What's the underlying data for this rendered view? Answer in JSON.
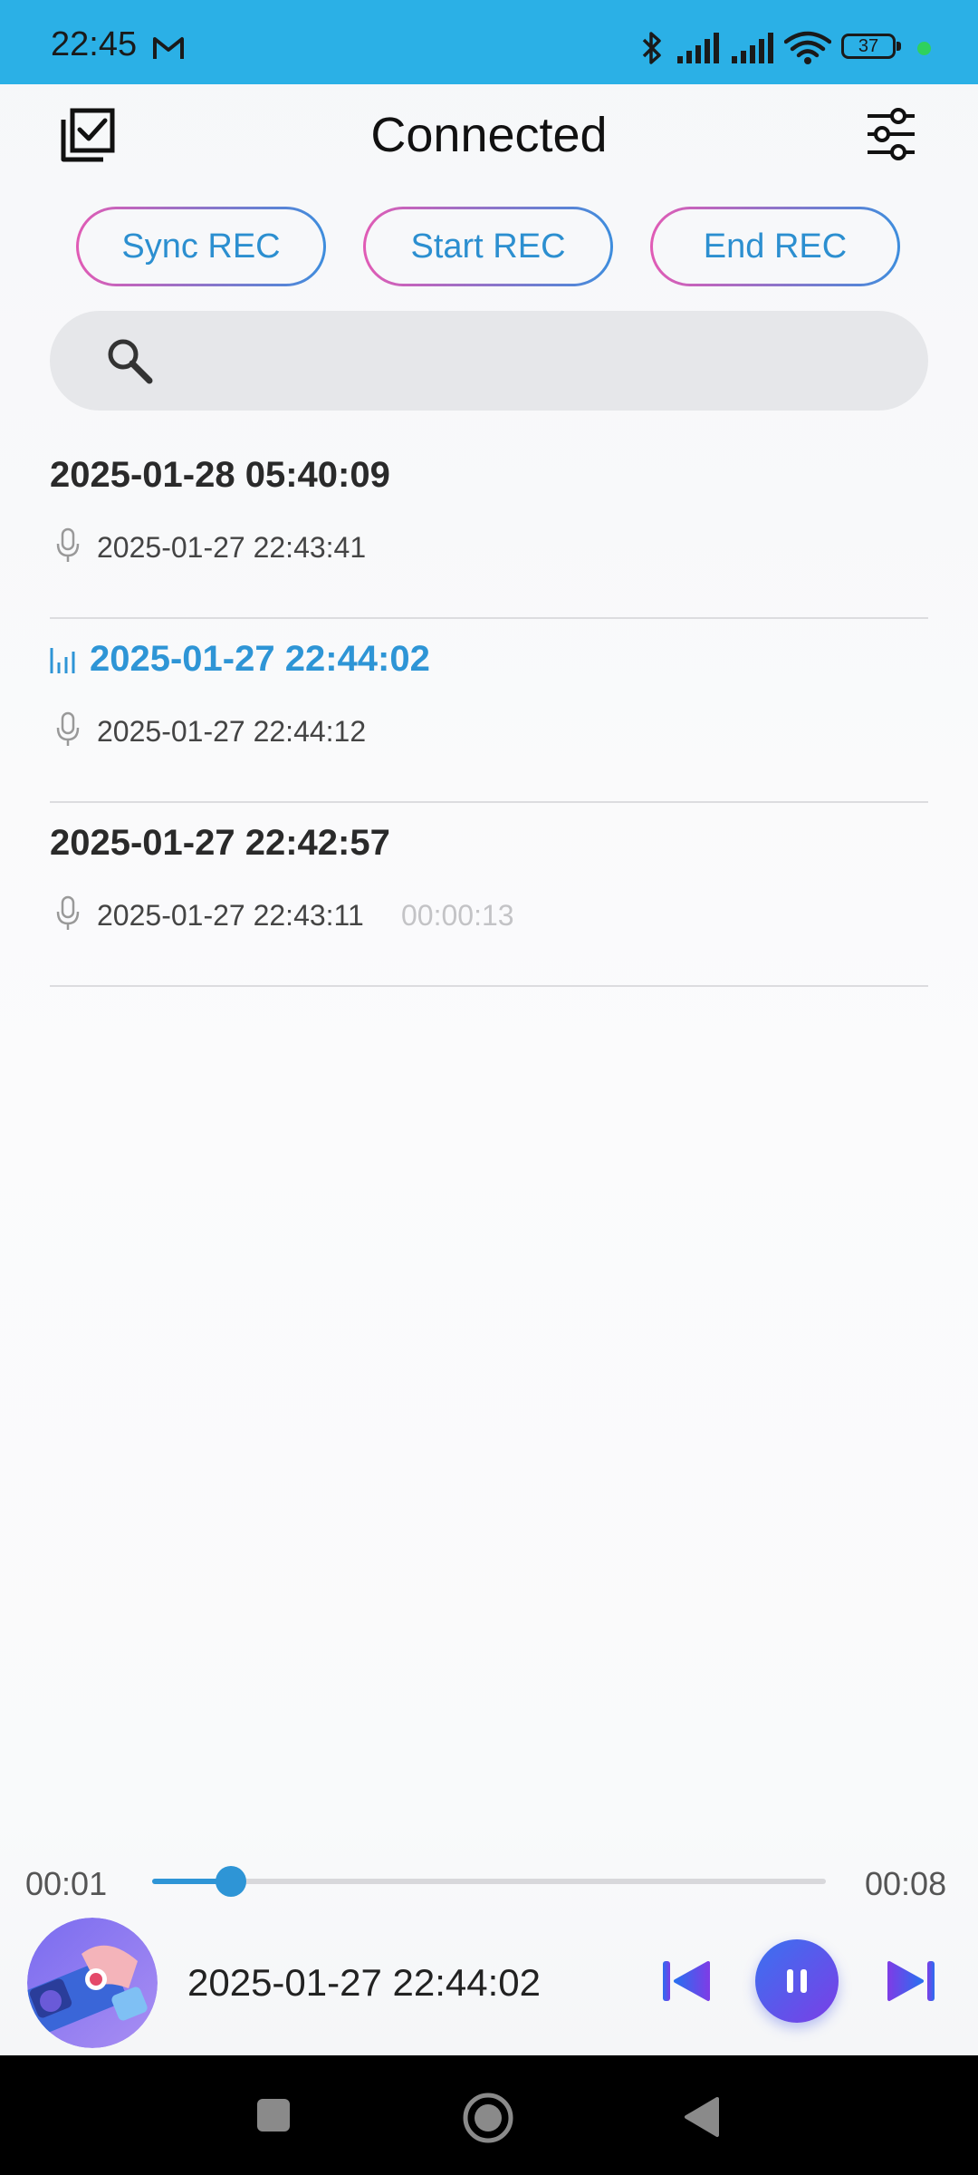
{
  "status_bar": {
    "time": "22:45",
    "battery": "37",
    "icons": [
      "mail-icon",
      "bluetooth-icon",
      "signal-icon",
      "signal-icon",
      "wifi-icon",
      "battery-icon"
    ]
  },
  "header": {
    "title": "Connected",
    "left_icon": "select-all-icon",
    "right_icon": "filter-settings-icon"
  },
  "rec_buttons": {
    "sync": "Sync REC",
    "start": "Start REC",
    "end": "End REC"
  },
  "search": {
    "placeholder": "",
    "icon": "search-icon"
  },
  "recordings": [
    {
      "title": "2025-01-28 05:40:09",
      "date": "2025-01-27 22:43:41",
      "duration": "",
      "playing": false
    },
    {
      "title": "2025-01-27 22:44:02",
      "date": "2025-01-27 22:44:12",
      "duration": "",
      "playing": true
    },
    {
      "title": "2025-01-27 22:42:57",
      "date": "2025-01-27 22:43:11",
      "duration": "00:00:13",
      "playing": false
    }
  ],
  "player": {
    "current_time": "00:01",
    "total_time": "00:08",
    "progress": 0.117,
    "title": "2025-01-27 22:44:02",
    "state": "playing"
  },
  "colors": {
    "status_bar": "#2bb0e6",
    "accent": "#2e95d6",
    "button_gradient_start": "#e15bb5",
    "button_gradient_end": "#3d8ddd",
    "pause_gradient_start": "#3a72f0",
    "pause_gradient_end": "#7b3ee6"
  }
}
